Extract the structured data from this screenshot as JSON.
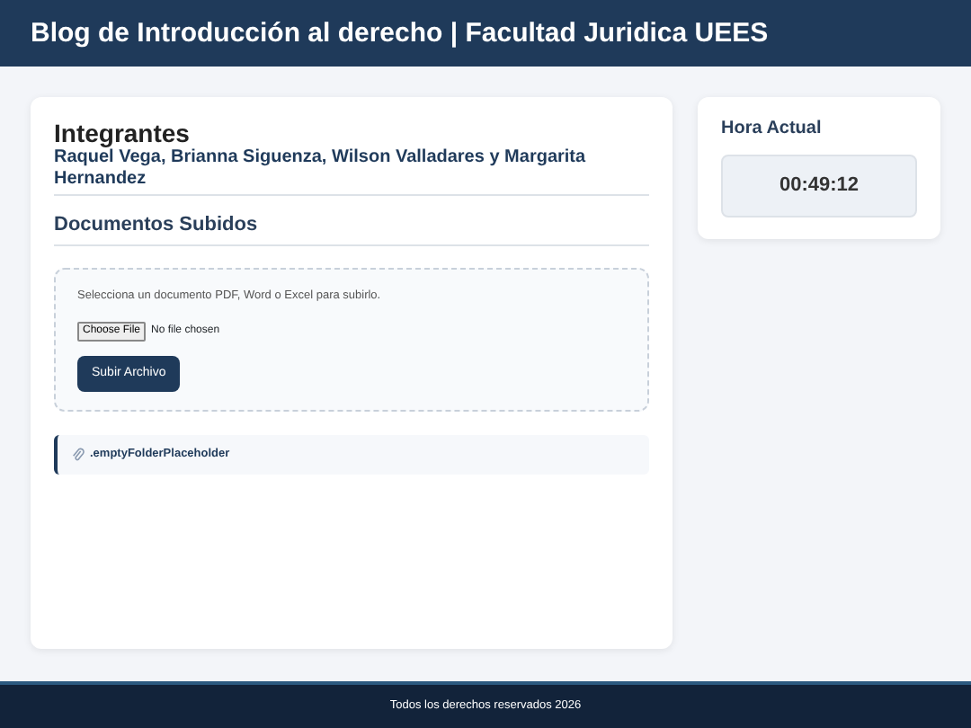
{
  "header": {
    "title": "Blog de Introducción al derecho | Facultad Juridica UEES"
  },
  "members": {
    "heading": "Integrantes",
    "names": "Raquel Vega, Brianna Siguenza, Wilson Valladares y Margarita Hernandez"
  },
  "documents": {
    "heading": "Documentos Subidos",
    "instructions": "Selecciona un documento PDF, Word o Excel para subirlo.",
    "file_button": "Choose File",
    "file_status": "No file chosen",
    "upload_button": "Subir Archivo",
    "files": [
      {
        "name": ".emptyFolderPlaceholder"
      }
    ]
  },
  "clock": {
    "heading": "Hora Actual",
    "time": "00:49:12"
  },
  "footer": {
    "text": "Todos los derechos reservados 2026"
  }
}
